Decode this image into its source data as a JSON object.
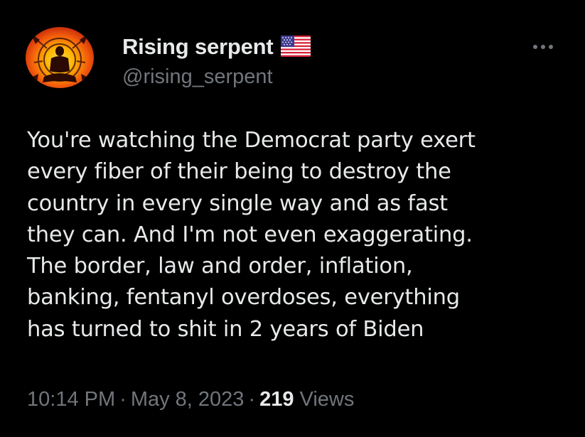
{
  "author": {
    "display_name": "Rising serpent",
    "handle": "@rising_serpent",
    "name_badge_icon": "us-flag-icon"
  },
  "more_button": {
    "icon": "more-horizontal-icon",
    "label": "…"
  },
  "tweet": {
    "text": "You're watching the Democrat party exert\nevery fiber of their being to destroy the\ncountry in every single way and as fast\nthey can. And I'm not even exaggerating.\nThe border, law and order, inflation,\nbanking, fentanyl overdoses, everything\nhas turned to shit in 2 years of Biden"
  },
  "meta": {
    "time": "10:14 PM",
    "separator": "·",
    "date": "May 8, 2023",
    "views_count": "219",
    "views_label": "Views"
  },
  "colors": {
    "background": "#000000",
    "primary_text": "#e7e9ea",
    "secondary_text": "#71767b",
    "avatar_outer": "#c62a10",
    "avatar_inner": "#ffb300"
  }
}
